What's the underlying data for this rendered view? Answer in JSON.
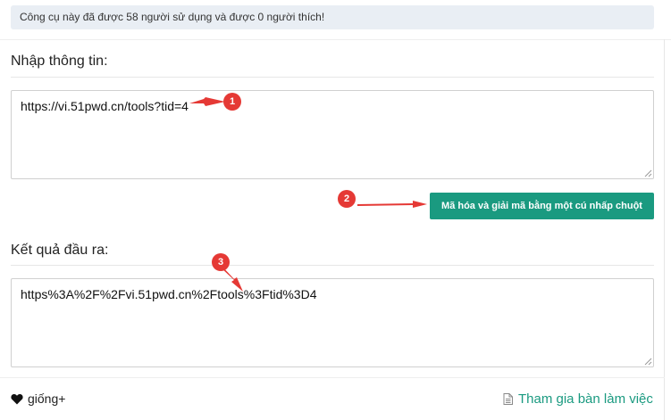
{
  "info_bar": {
    "text": "Công cụ này đã được 58 người sử dụng và được 0 người thích!"
  },
  "input_section": {
    "title": "Nhập thông tin:",
    "value": "https://vi.51pwd.cn/tools?tid=4"
  },
  "action_button": {
    "label": "Mã hóa và giải mã bằng một cú nhấp chuột"
  },
  "output_section": {
    "title": "Kết quả đầu ra:",
    "value": "https%3A%2F%2Fvi.51pwd.cn%2Ftools%3Ftid%3D4"
  },
  "footer": {
    "like_label": "giống+",
    "workbench_label": "Tham gia bàn làm việc"
  },
  "annotations": {
    "badge1": "1",
    "badge2": "2",
    "badge3": "3"
  },
  "colors": {
    "accent": "#1a9a80",
    "annotation": "#e53935",
    "info_bg": "#e9eef4"
  },
  "icons": {
    "like": "heart-icon",
    "workbench": "document-icon"
  }
}
